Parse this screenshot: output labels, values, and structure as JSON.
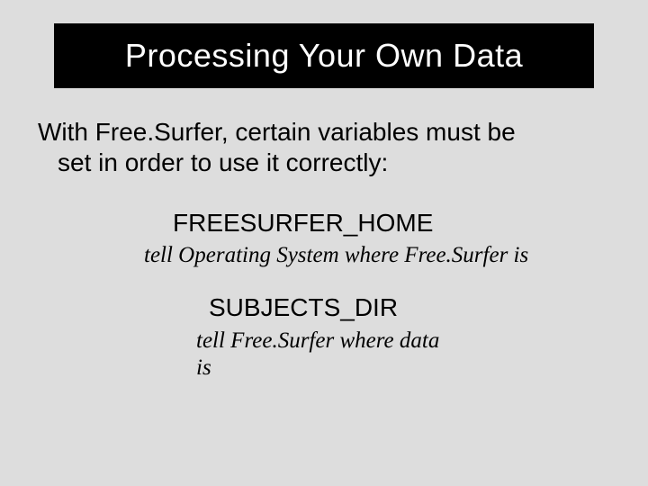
{
  "title": "Processing Your Own Data",
  "intro_line1": "With Free.Surfer, certain variables must be",
  "intro_line2": "set in order to use it correctly:",
  "vars": [
    {
      "name": "FREESURFER_HOME",
      "desc": "tell Operating System where Free.Surfer is"
    },
    {
      "name": "SUBJECTS_DIR",
      "desc": "tell Free.Surfer where data is"
    }
  ]
}
